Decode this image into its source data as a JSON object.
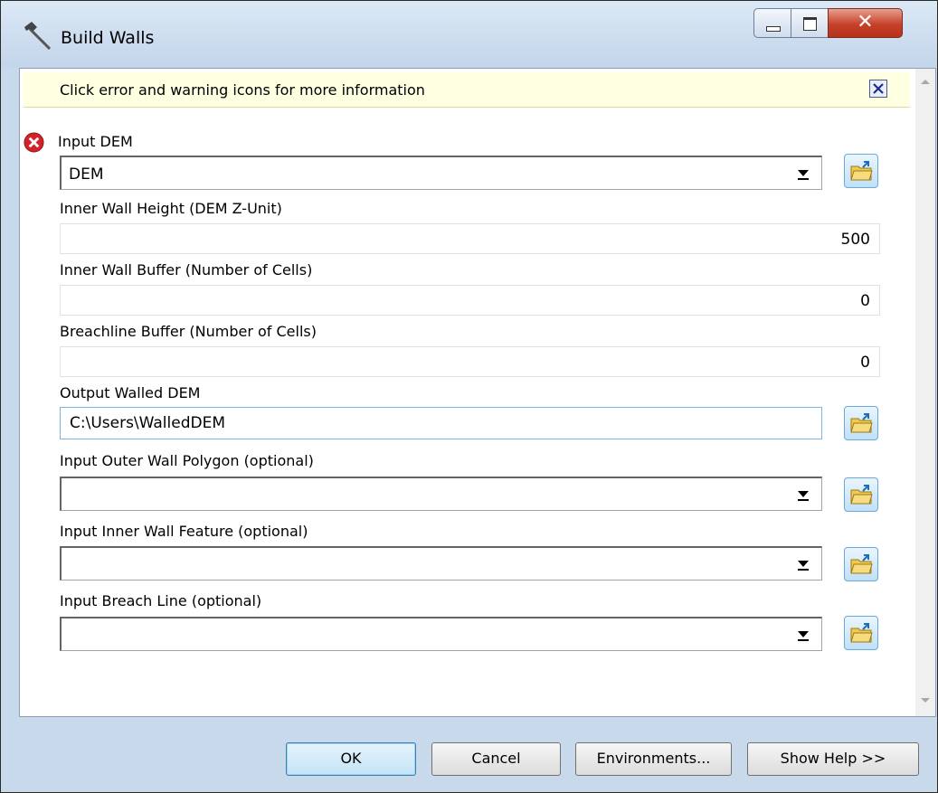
{
  "window": {
    "title": "Build Walls",
    "title_icon": "hammer-icon",
    "controls": [
      "minimize-icon",
      "maximize-icon",
      "close-icon"
    ]
  },
  "message_bar": {
    "text": "Click error and warning icons for more information",
    "close_icon": "close-box-icon"
  },
  "fields": {
    "input_dem": {
      "label": "Input DEM",
      "value": "DEM",
      "status_icon": "error-icon"
    },
    "inner_wall_height": {
      "label": "Inner Wall Height (DEM Z-Unit)",
      "value": "500"
    },
    "inner_wall_buffer": {
      "label": "Inner Wall Buffer (Number of Cells)",
      "value": "0"
    },
    "breachline_buffer": {
      "label": "Breachline Buffer (Number of Cells)",
      "value": "0"
    },
    "output_walled_dem": {
      "label": "Output Walled DEM",
      "value": "C:\\Users\\WalledDEM"
    },
    "outer_wall_polygon": {
      "label": "Input Outer Wall Polygon (optional)",
      "value": ""
    },
    "inner_wall_feature": {
      "label": "Input Inner Wall Feature (optional)",
      "value": ""
    },
    "breach_line": {
      "label": "Input Breach Line (optional)",
      "value": ""
    }
  },
  "buttons": {
    "ok": "OK",
    "cancel": "Cancel",
    "environments": "Environments...",
    "show_help": "Show Help >>"
  },
  "colors": {
    "title_bar": "#c9d9ec",
    "message_bar": "#ffffe1",
    "close_button": "#c6412a",
    "error_icon": "#d2232a",
    "ok_button": "#c4e4f7"
  }
}
